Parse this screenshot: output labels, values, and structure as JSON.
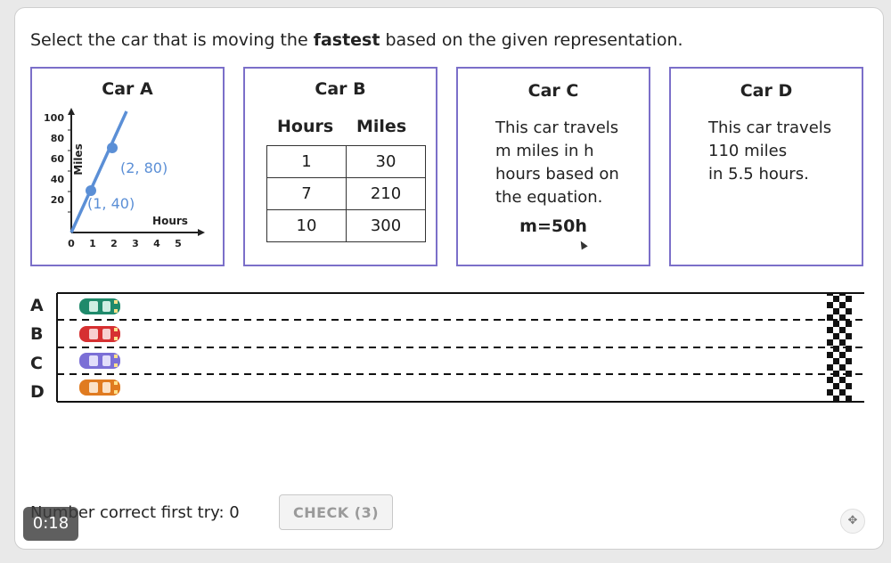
{
  "prompt": {
    "before": "Select the car that is moving the ",
    "bold": "fastest",
    "after": " based on the given representation."
  },
  "cards": {
    "a": {
      "title": "Car A",
      "graph": {
        "ylabel": "Miles",
        "xlabel": "Hours",
        "y_ticks": [
          "100",
          "80",
          "60",
          "40",
          "20"
        ],
        "x_ticks": [
          "0",
          "1",
          "2",
          "3",
          "4",
          "5"
        ],
        "point1": "(1, 40)",
        "point2": "(2, 80)",
        "line_color": "#5b8fd6"
      }
    },
    "b": {
      "title": "Car B",
      "col1": "Hours",
      "col2": "Miles",
      "rows": [
        [
          "1",
          "30"
        ],
        [
          "7",
          "210"
        ],
        [
          "10",
          "300"
        ]
      ]
    },
    "c": {
      "title": "Car C",
      "line1": "This car travels",
      "line2": "m miles in h",
      "line3": "hours based on",
      "line4": "the equation.",
      "equation": "m=50h"
    },
    "d": {
      "title": "Car D",
      "line1": "This car travels",
      "line2": "110 miles",
      "line3": "in 5.5 hours."
    }
  },
  "track": {
    "lanes": [
      {
        "label": "A",
        "car_color": "#1f8a6b"
      },
      {
        "label": "B",
        "car_color": "#d63031"
      },
      {
        "label": "C",
        "car_color": "#7b6fd6"
      },
      {
        "label": "D",
        "car_color": "#e07b20"
      }
    ]
  },
  "footer": {
    "score_text": "Number correct first try: 0",
    "check_label": "CHECK (3)",
    "timer": "0:18",
    "fullscreen_icon": "collapse-icon"
  },
  "colors": {
    "card_border": "#7b6fc9",
    "accent_blue": "#5b8fd6"
  }
}
